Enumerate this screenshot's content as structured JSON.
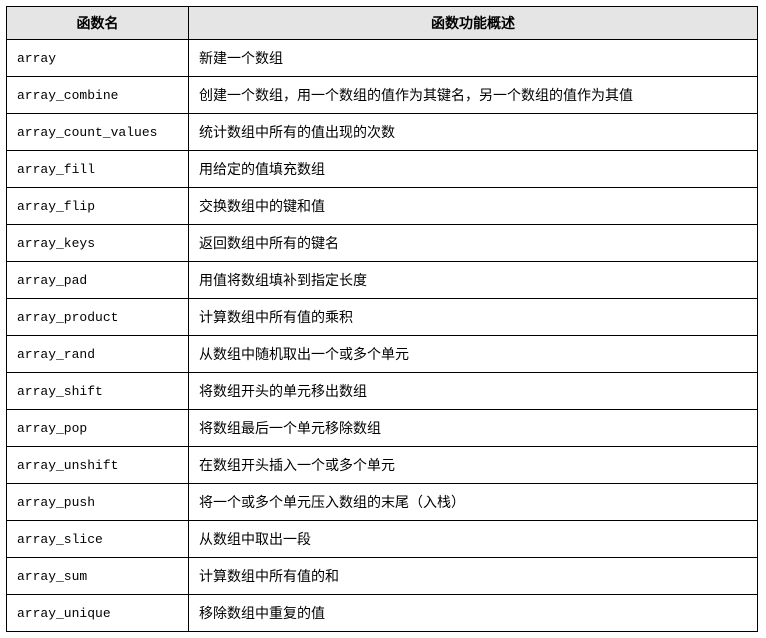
{
  "table": {
    "headers": {
      "name": "函数名",
      "desc": "函数功能概述"
    },
    "rows": [
      {
        "name": "array",
        "desc": "新建一个数组"
      },
      {
        "name": "array_combine",
        "desc": "创建一个数组，用一个数组的值作为其键名，另一个数组的值作为其值"
      },
      {
        "name": "array_count_values",
        "desc": "统计数组中所有的值出现的次数"
      },
      {
        "name": "array_fill",
        "desc": "用给定的值填充数组"
      },
      {
        "name": "array_flip",
        "desc": "交换数组中的键和值"
      },
      {
        "name": "array_keys",
        "desc": "返回数组中所有的键名"
      },
      {
        "name": "array_pad",
        "desc": "用值将数组填补到指定长度"
      },
      {
        "name": "array_product",
        "desc": "计算数组中所有值的乘积"
      },
      {
        "name": "array_rand",
        "desc": "从数组中随机取出一个或多个单元"
      },
      {
        "name": "array_shift",
        "desc": "将数组开头的单元移出数组"
      },
      {
        "name": "array_pop",
        "desc": "将数组最后一个单元移除数组"
      },
      {
        "name": "array_unshift",
        "desc": "在数组开头插入一个或多个单元"
      },
      {
        "name": "array_push",
        "desc": "将一个或多个单元压入数组的末尾（入栈）"
      },
      {
        "name": "array_slice",
        "desc": "从数组中取出一段"
      },
      {
        "name": "array_sum",
        "desc": "计算数组中所有值的和"
      },
      {
        "name": "array_unique",
        "desc": "移除数组中重复的值"
      }
    ]
  }
}
